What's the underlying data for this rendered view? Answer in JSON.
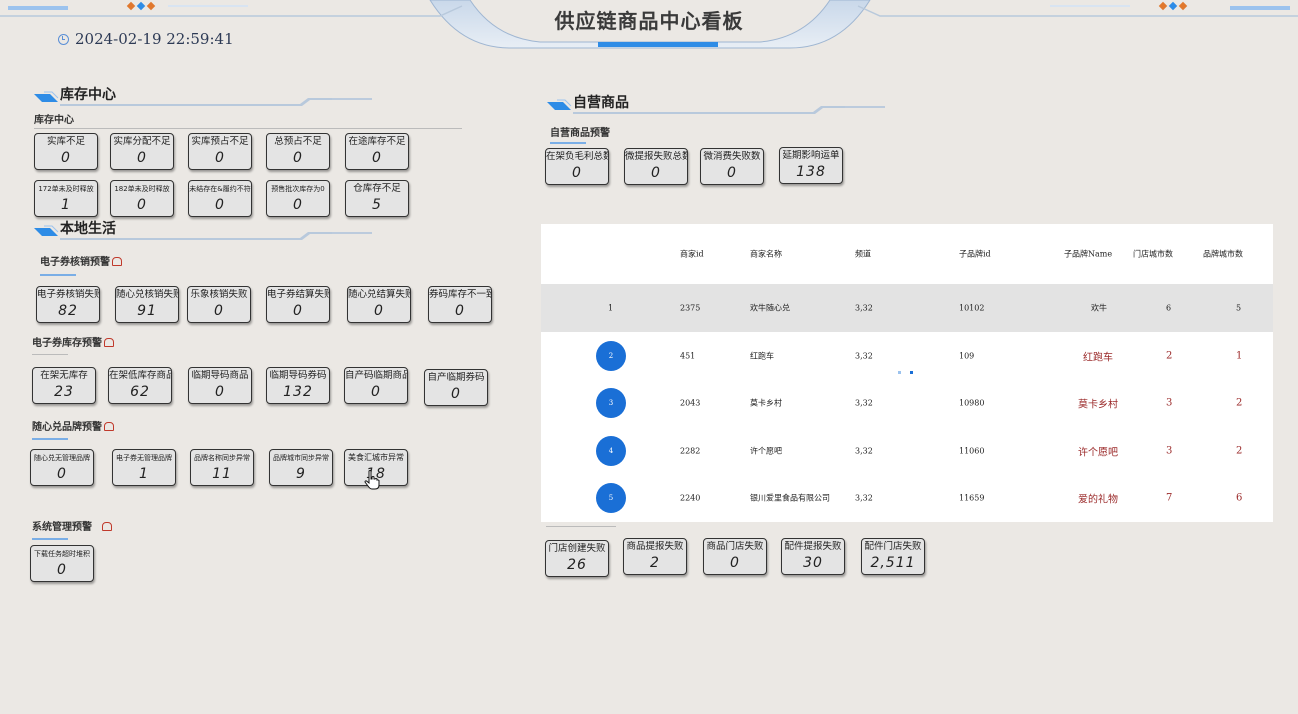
{
  "header": {
    "title": "供应链商品中心看板",
    "datetime": "2024-02-19 22:59:41"
  },
  "inventory": {
    "section_title": "库存中心",
    "sub_title": "库存中心",
    "cards": [
      {
        "label": "实库不足",
        "value": "0"
      },
      {
        "label": "实库分配不足",
        "value": "0"
      },
      {
        "label": "实库预占不足",
        "value": "0"
      },
      {
        "label": "总预占不足",
        "value": "0"
      },
      {
        "label": "在途库存不足",
        "value": "0"
      },
      {
        "label": "172单未及时释放",
        "value": "1"
      },
      {
        "label": "182单未及时释放",
        "value": "0"
      },
      {
        "label": "未结存在&履约不符",
        "value": "0"
      },
      {
        "label": "预售批次库存为0",
        "value": "0"
      },
      {
        "label": "仓库存不足",
        "value": "5"
      }
    ]
  },
  "local_life": {
    "section_title": "本地生活",
    "coupon_writeoff": {
      "title": "电子券核销预警",
      "cards": [
        {
          "label": "电子券核销失败",
          "value": "82"
        },
        {
          "label": "随心兑核销失败",
          "value": "91"
        },
        {
          "label": "乐象核销失败",
          "value": "0"
        },
        {
          "label": "电子券结算失败",
          "value": "0"
        },
        {
          "label": "随心兑结算失败",
          "value": "0"
        },
        {
          "label": "券码库存不一致",
          "value": "0"
        }
      ]
    },
    "coupon_stock": {
      "title": "电子券库存预警",
      "cards": [
        {
          "label": "在架无库存",
          "value": "23"
        },
        {
          "label": "在架低库存商品",
          "value": "62"
        },
        {
          "label": "临期导码商品",
          "value": "0"
        },
        {
          "label": "临期导码券码",
          "value": "132"
        },
        {
          "label": "自产码临期商品",
          "value": "0"
        },
        {
          "label": "自产临期券码",
          "value": "0"
        }
      ]
    },
    "brand": {
      "title": "随心兑品牌预警",
      "cards": [
        {
          "label": "随心兑无管理品牌",
          "value": "0"
        },
        {
          "label": "电子券无管理品牌",
          "value": "1"
        },
        {
          "label": "品牌名称同步异常",
          "value": "11"
        },
        {
          "label": "品牌城市同步异常",
          "value": "9"
        },
        {
          "label": "美食汇城市异常",
          "value": "18"
        }
      ]
    },
    "system": {
      "title": "系统管理预警",
      "cards": [
        {
          "label": "下载任务超时堆积",
          "value": "0"
        }
      ]
    }
  },
  "self_op": {
    "section_title": "自营商品",
    "alert_title": "自营商品预警",
    "cards": [
      {
        "label": "在架负毛利总数",
        "value": "0"
      },
      {
        "label": "微提报失败总数",
        "value": "0"
      },
      {
        "label": "微消费失败数",
        "value": "0"
      },
      {
        "label": "延期影响运单",
        "value": "138"
      }
    ],
    "table": {
      "columns": [
        "商家id",
        "商家名称",
        "频道",
        "子品牌id",
        "子品牌Name",
        "门店城市数",
        "品牌城市数"
      ],
      "rows": [
        {
          "rank": "1",
          "merchant_id": "2375",
          "name": "欢牛随心兑",
          "channel": "3,32",
          "brand_id": "10102",
          "brand_name": "欢牛",
          "store_cities": "6",
          "brand_cities": "5"
        },
        {
          "rank": "2",
          "merchant_id": "451",
          "name": "红跑车",
          "channel": "3,32",
          "brand_id": "109",
          "brand_name": "红跑车",
          "store_cities": "2",
          "brand_cities": "1"
        },
        {
          "rank": "3",
          "merchant_id": "2043",
          "name": "莫卡乡村",
          "channel": "3,32",
          "brand_id": "10980",
          "brand_name": "莫卡乡村",
          "store_cities": "3",
          "brand_cities": "2"
        },
        {
          "rank": "4",
          "merchant_id": "2282",
          "name": "许个愿吧",
          "channel": "3,32",
          "brand_id": "11060",
          "brand_name": "许个愿吧",
          "store_cities": "3",
          "brand_cities": "2"
        },
        {
          "rank": "5",
          "merchant_id": "2240",
          "name": "银川爱里食品有限公司",
          "channel": "3,32",
          "brand_id": "11659",
          "brand_name": "爱的礼物",
          "store_cities": "7",
          "brand_cities": "6"
        }
      ]
    },
    "bottom_cards": [
      {
        "label": "门店创建失败",
        "value": "26"
      },
      {
        "label": "商品提报失败",
        "value": "2"
      },
      {
        "label": "商品门店失败",
        "value": "0"
      },
      {
        "label": "配件提报失败",
        "value": "30"
      },
      {
        "label": "配件门店失败",
        "value": "2,511"
      }
    ]
  },
  "colors": {
    "accent": "#1a6fd6",
    "highlight": "#9b2a2a",
    "alarm": "#c0392b"
  }
}
